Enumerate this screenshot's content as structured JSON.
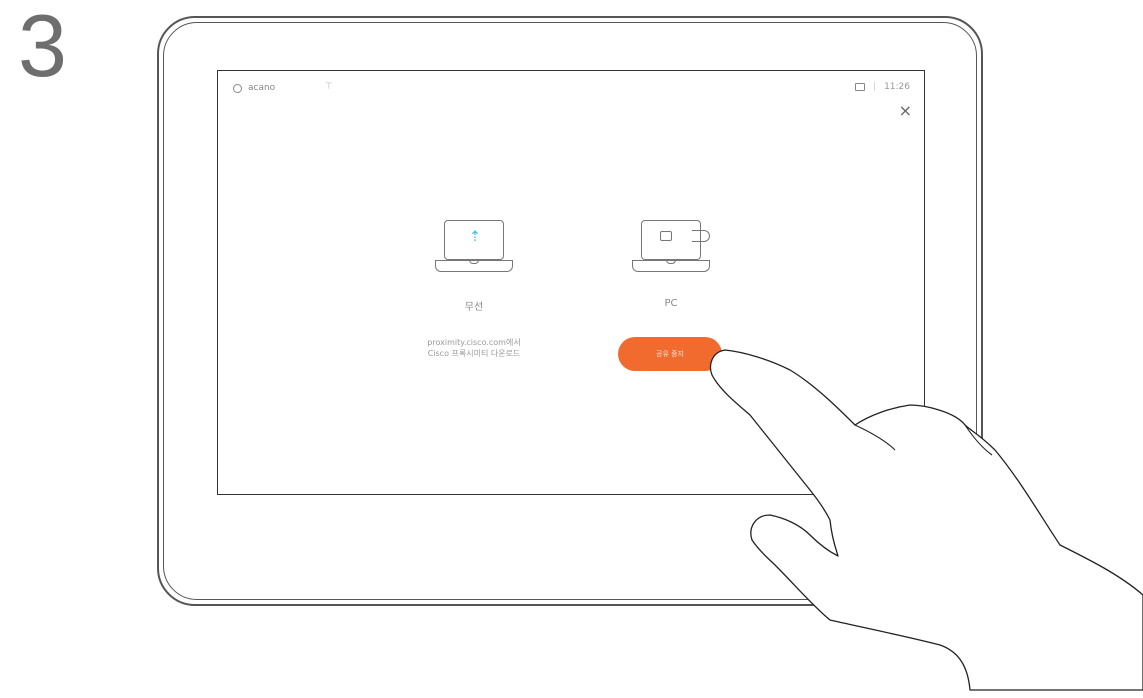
{
  "step": {
    "number": "3"
  },
  "topbar": {
    "brand": "acano",
    "time": "11:26",
    "separator": "|"
  },
  "icons": {
    "brand": "logo-icon",
    "wifi": "wifi-icon",
    "camera": "camera-icon",
    "close": "close-icon",
    "close_glyph": "×"
  },
  "options": [
    {
      "label": "무선",
      "icon": "laptop-wireless-icon"
    },
    {
      "label": "PC",
      "icon": "laptop-cable-icon"
    }
  ],
  "wireless_desc": {
    "line1": "proximity.cisco.com에서",
    "line2": "Cisco 프록시미티 다운로드"
  },
  "action_button": {
    "label": "공유 중지"
  },
  "colors": {
    "accent": "#f26b2e",
    "wifi": "#3ab4e8"
  }
}
